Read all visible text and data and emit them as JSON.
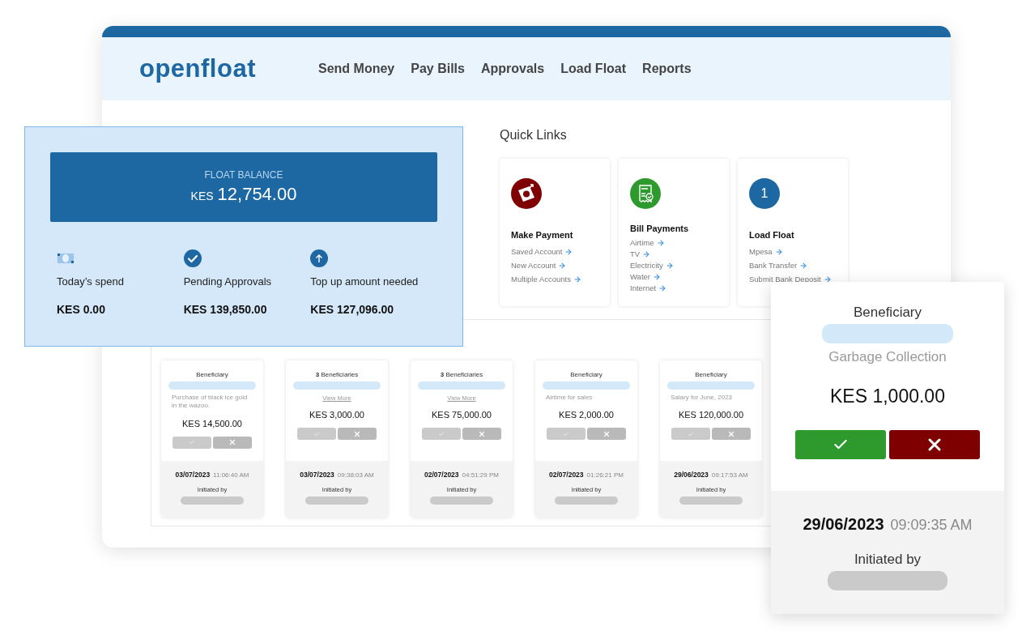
{
  "header": {
    "logo": "openfloat",
    "nav": [
      "Send Money",
      "Pay Bills",
      "Approvals",
      "Load Float",
      "Reports"
    ]
  },
  "balance_card": {
    "label": "FLOAT BALANCE",
    "currency": "KES",
    "amount": "12,754.00",
    "stats": [
      {
        "kind": "cash",
        "label": "Today’s spend",
        "value": "KES 0.00"
      },
      {
        "kind": "check",
        "label": "Pending Approvals",
        "value": "KES 139,850.00"
      },
      {
        "kind": "up",
        "label": "Top up amount needed",
        "value": "KES 127,096.00"
      }
    ]
  },
  "quick_links": {
    "title": "Quick Links",
    "cards": [
      {
        "kind": "payment",
        "title": "Make Payment",
        "links": [
          "Saved Account",
          "New Account",
          "Multiple Accounts"
        ]
      },
      {
        "kind": "bill",
        "title": "Bill Payments",
        "links": [
          "Airtime",
          "TV",
          "Electricity",
          "Water",
          "Internet"
        ]
      },
      {
        "kind": "number",
        "badge": "1",
        "title": "Load Float",
        "links": [
          "Mpesa",
          "Bank Transfer",
          "Submit Bank Deposit"
        ]
      }
    ]
  },
  "approvals": [
    {
      "beneficiary": "Beneficiary",
      "description": "Purchase of black ice gold in the wazoo.",
      "amount": "KES 14,500.00",
      "actions_enabled": false,
      "date": "03/07/2023",
      "time": "11:06:40 AM",
      "initiated_label": "Initiated by"
    },
    {
      "beneficiary": "**3** Beneficiaries",
      "view_more": "View More",
      "amount": "KES 3,000.00",
      "actions_enabled": false,
      "date": "03/07/2023",
      "time": "09:38:03 AM",
      "initiated_label": "Initiated by"
    },
    {
      "beneficiary": "**3** Beneficiaries",
      "view_more": "View More",
      "amount": "KES 75,000.00",
      "actions_enabled": false,
      "date": "02/07/2023",
      "time": "04:51:29 PM",
      "initiated_label": "Initiated by"
    },
    {
      "beneficiary": "Beneficiary",
      "description": "Airtime for sales",
      "amount": "KES 2,000.00",
      "actions_enabled": false,
      "date": "02/07/2023",
      "time": "01:26:21 PM",
      "initiated_label": "Initiated by"
    },
    {
      "beneficiary": "Beneficiary",
      "description": "Salary for June, 2023",
      "amount": "KES 120,000.00",
      "actions_enabled": false,
      "date": "29/06/2023",
      "time": "09:17:53 AM",
      "initiated_label": "Initiated by"
    }
  ],
  "featured_approval": {
    "beneficiary": "Beneficiary",
    "description": "Garbage Collection",
    "amount": "KES 1,000.00",
    "actions_enabled": true,
    "date": "29/06/2023",
    "time": "09:09:35 AM",
    "initiated_label": "Initiated by"
  }
}
